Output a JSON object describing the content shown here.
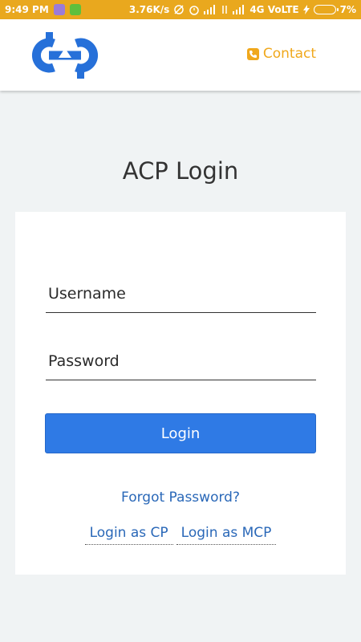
{
  "status_bar": {
    "time": "9:49 PM",
    "speed": "3.76K/s",
    "network": "4G VoLTE",
    "battery": "7%"
  },
  "header": {
    "logo_icon": "company-logo",
    "contact_label": "Contact",
    "contact_icon": "phone-icon",
    "accent": "#f0a81c"
  },
  "page": {
    "title": "ACP Login"
  },
  "form": {
    "username_placeholder": "Username",
    "password_placeholder": "Password",
    "login_label": "Login",
    "forgot_label": "Forgot Password?",
    "login_cp_label": "Login as CP",
    "login_mcp_label": "Login as MCP",
    "button_color": "#2f7ae5",
    "link_color": "#2a68b8"
  }
}
